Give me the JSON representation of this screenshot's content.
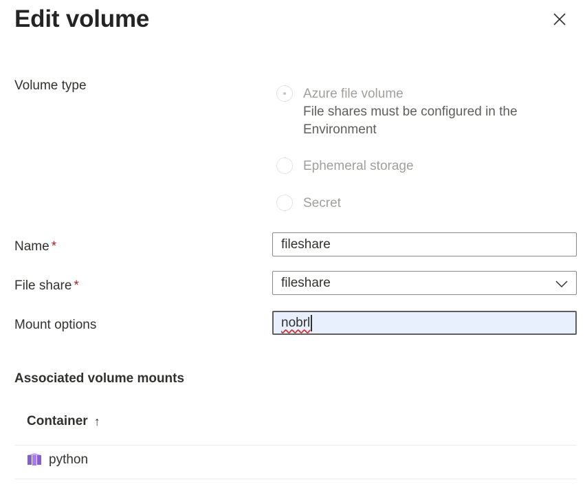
{
  "panel": {
    "title": "Edit volume"
  },
  "form": {
    "volume_type_label": "Volume type",
    "volume_type_options": [
      {
        "label": "Azure file volume",
        "description_line1": "File shares must be configured in the",
        "description_line2": "Environment",
        "selected": true
      },
      {
        "label": "Ephemeral storage",
        "selected": false
      },
      {
        "label": "Secret",
        "selected": false
      }
    ],
    "name_label": "Name",
    "name_value": "fileshare",
    "file_share_label": "File share",
    "file_share_value": "fileshare",
    "mount_options_label": "Mount options",
    "mount_options_value": "nobrl",
    "required_marker": "*"
  },
  "mounts": {
    "section_title": "Associated volume mounts",
    "column_header": "Container",
    "sort_indicator": "↑",
    "rows": [
      {
        "container": "python",
        "icon": "container-app-icon"
      }
    ]
  },
  "colors": {
    "required": "#a4262c",
    "focus_bg": "#e8f0fe",
    "icon_purple": "#8661c5"
  }
}
